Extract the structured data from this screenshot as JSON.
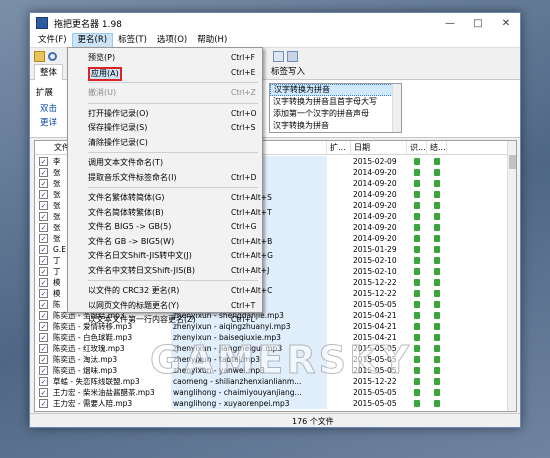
{
  "window": {
    "title": "拖把更名器 1.98"
  },
  "titlebar": {
    "minimize": "—",
    "maximize": "□",
    "close": "✕"
  },
  "menubar": [
    {
      "label": "文件(F)"
    },
    {
      "label": "更名(R)"
    },
    {
      "label": "标签(T)"
    },
    {
      "label": "选项(O)"
    },
    {
      "label": "帮助(H)"
    }
  ],
  "tabs": {
    "whole": "整体",
    "tag_write": "标签写入"
  },
  "panel": {
    "left_label": "扩展",
    "link1": "双击",
    "link2": "更详",
    "pinyin_options": [
      "汉字转换为拼音",
      "汉字转换为拼音且首字母大写",
      "添加第一个汉字的拼音声母",
      "汉字转换为拼音"
    ]
  },
  "table": {
    "headers": {
      "name": "文件",
      "new_name": "",
      "ext": "扩...",
      "date": "日期",
      "flag1": "识...",
      "flag2": "结..."
    },
    "rows": [
      {
        "name": "李",
        "new": "ngjiang.mp3",
        "date": "2015-02-09"
      },
      {
        "name": "张",
        "new": "zhufu.mp3",
        "date": "2014-09-20"
      },
      {
        "name": "张",
        "new": "nshijieyu...",
        "date": "2014-09-20"
      },
      {
        "name": "张",
        "new": "mp3",
        "date": "2014-09-20"
      },
      {
        "name": "张",
        "new": "mp3",
        "date": "2014-09-20"
      },
      {
        "name": "张",
        "new": "ngaini.mp3",
        "date": "2014-09-20"
      },
      {
        "name": "张",
        "new": "zhuai.mp3",
        "date": "2014-09-20"
      },
      {
        "name": "张",
        "new": "ishemedouh...",
        "date": "2014-09-20"
      },
      {
        "name": "G.E",
        "new": "shaoguanzu...",
        "date": "2015-01-29"
      },
      {
        "name": "丁",
        "new": "yibuyu.mp3",
        "date": "2015-02-10"
      },
      {
        "name": "丁",
        "new": "mp3",
        "date": "2015-02-10"
      },
      {
        "name": "模",
        "new": "ihuiyi.mp3",
        "date": "2015-12-22"
      },
      {
        "name": "模",
        "new": "We Talk.mp3",
        "date": "2015-12-22"
      },
      {
        "name": "陈",
        "new": "mp3",
        "date": "2015-05-05"
      },
      {
        "name": "陈奕迅 - 圣誕结.mp3",
        "new": "zhenyixun - shengdanjie.mp3",
        "date": "2015-04-21"
      },
      {
        "name": "陈奕迅 - 爱情转移.mp3",
        "new": "zhenyixun - aiqingzhuanyi.mp3",
        "date": "2015-04-21"
      },
      {
        "name": "陈奕迅 - 白色球鞋.mp3",
        "new": "zhenyixun - baiseqiuxie.mp3",
        "date": "2015-04-21"
      },
      {
        "name": "陈奕迅 - 红玫瑰.mp3",
        "new": "zhenyixun - jiangmeigui.mp3",
        "date": "2015-05-05"
      },
      {
        "name": "陈奕迅 - 淘汰.mp3",
        "new": "zhenyixun - taotai.mp3",
        "date": "2015-05-05"
      },
      {
        "name": "陈奕迅 - 烟味.mp3",
        "new": "zhenyixun - yanwei.mp3",
        "date": "2015-05-05"
      },
      {
        "name": "草蜢 - 失恋阵线联盟.mp3",
        "new": "caomeng - shilianzhenxianlianm...",
        "date": "2015-12-22"
      },
      {
        "name": "王力宏 - 柴米油盐酱醋茶.mp3",
        "new": "wanglihong - chaimiyouyanjiang...",
        "date": "2015-05-05"
      },
      {
        "name": "王力宏 - 需要人陪.mp3",
        "new": "wanglihong - xuyaorenpei.mp3",
        "date": "2015-05-05"
      }
    ]
  },
  "status": {
    "file_count": "176 个文件"
  },
  "dropdown": {
    "items": [
      {
        "label": "预览(P)",
        "shortcut": "Ctrl+F",
        "state": "normal"
      },
      {
        "label": "应用(A)",
        "shortcut": "Ctrl+E",
        "state": "highlight"
      },
      {
        "label": "撤消(U)",
        "shortcut": "Ctrl+Z",
        "state": "disabled"
      },
      {
        "label": "打开操作记录(O)",
        "shortcut": "Ctrl+O",
        "state": "normal"
      },
      {
        "label": "保存操作记录(S)",
        "shortcut": "Ctrl+S",
        "state": "normal"
      },
      {
        "label": "清除操作记录(C)",
        "shortcut": "",
        "state": "normal"
      },
      {
        "label": "调用文本文件命名(T)",
        "shortcut": "",
        "state": "normal"
      },
      {
        "label": "提取音乐文件标签命名(I)",
        "shortcut": "Ctrl+D",
        "state": "normal"
      },
      {
        "label": "文件名繁体转简体(G)",
        "shortcut": "Ctrl+Alt+S",
        "state": "normal"
      },
      {
        "label": "文件名简体转繁体(B)",
        "shortcut": "Ctrl+Alt+T",
        "state": "normal"
      },
      {
        "label": "文件名 BIG5 -> GB(5)",
        "shortcut": "Ctrl+G",
        "state": "normal"
      },
      {
        "label": "文件名 GB -> BIG5(W)",
        "shortcut": "Ctrl+Alt+B",
        "state": "normal"
      },
      {
        "label": "文件名日文Shift-JIS转中文(J)",
        "shortcut": "Ctrl+Alt+G",
        "state": "normal"
      },
      {
        "label": "文件名中文转日文Shift-JIS(B)",
        "shortcut": "Ctrl+Alt+J",
        "state": "normal"
      },
      {
        "label": "以文件的 CRC32 更名(R)",
        "shortcut": "Ctrl+Alt+C",
        "state": "normal"
      },
      {
        "label": "以网页文件的标题更名(Y)",
        "shortcut": "Ctrl+T",
        "state": "normal"
      },
      {
        "label": "以文本文件第一行内容更名(Z)",
        "shortcut": "Ctrl+L",
        "state": "normal"
      }
    ]
  },
  "watermark": "GAMERSKY",
  "colors": {
    "accent": "#3d7fcf",
    "highlight_box": "#dd2222",
    "status_green": "#3aa53a"
  }
}
